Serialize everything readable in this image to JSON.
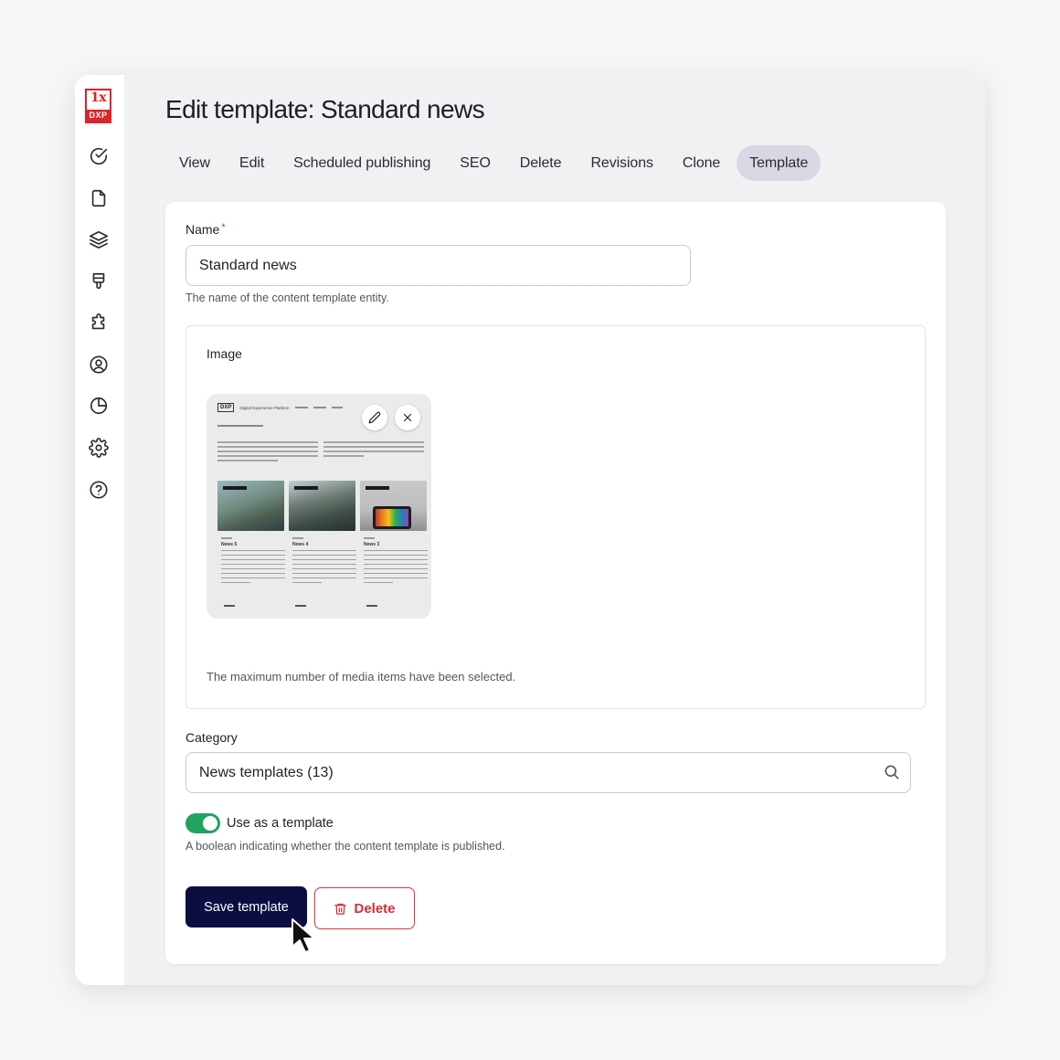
{
  "logo": {
    "top": "1x",
    "bottom": "DXP"
  },
  "sidebar": {
    "items": [
      {
        "name": "check-circle-icon"
      },
      {
        "name": "document-icon"
      },
      {
        "name": "layers-icon"
      },
      {
        "name": "paint-brush-icon"
      },
      {
        "name": "puzzle-icon"
      },
      {
        "name": "user-circle-icon"
      },
      {
        "name": "pie-chart-icon"
      },
      {
        "name": "gear-icon"
      },
      {
        "name": "help-icon"
      }
    ]
  },
  "page": {
    "title": "Edit template: Standard news"
  },
  "tabs": [
    {
      "label": "View",
      "active": false
    },
    {
      "label": "Edit",
      "active": false
    },
    {
      "label": "Scheduled publishing",
      "active": false
    },
    {
      "label": "SEO",
      "active": false
    },
    {
      "label": "Delete",
      "active": false
    },
    {
      "label": "Revisions",
      "active": false
    },
    {
      "label": "Clone",
      "active": false
    },
    {
      "label": "Template",
      "active": true
    }
  ],
  "form": {
    "name": {
      "label": "Name",
      "required_mark": "*",
      "value": "Standard news",
      "help": "The name of the content template entity."
    },
    "image": {
      "label": "Image",
      "help": "The maximum number of media items have been selected.",
      "thumbnail": {
        "logo": "DXP",
        "site_title": "Digital Experience Platform",
        "news_titles": [
          "News 5",
          "News 4",
          "News 3"
        ]
      }
    },
    "category": {
      "label": "Category",
      "value": "News templates (13)"
    },
    "use_as_template": {
      "label": "Use as a template",
      "checked": true,
      "help": "A boolean indicating whether the content template is published."
    },
    "save_label": "Save template",
    "delete_label": "Delete"
  },
  "colors": {
    "accent": "#0c0d40",
    "danger": "#d9353b",
    "toggle_on": "#22a45f",
    "brand": "#d9252b"
  }
}
